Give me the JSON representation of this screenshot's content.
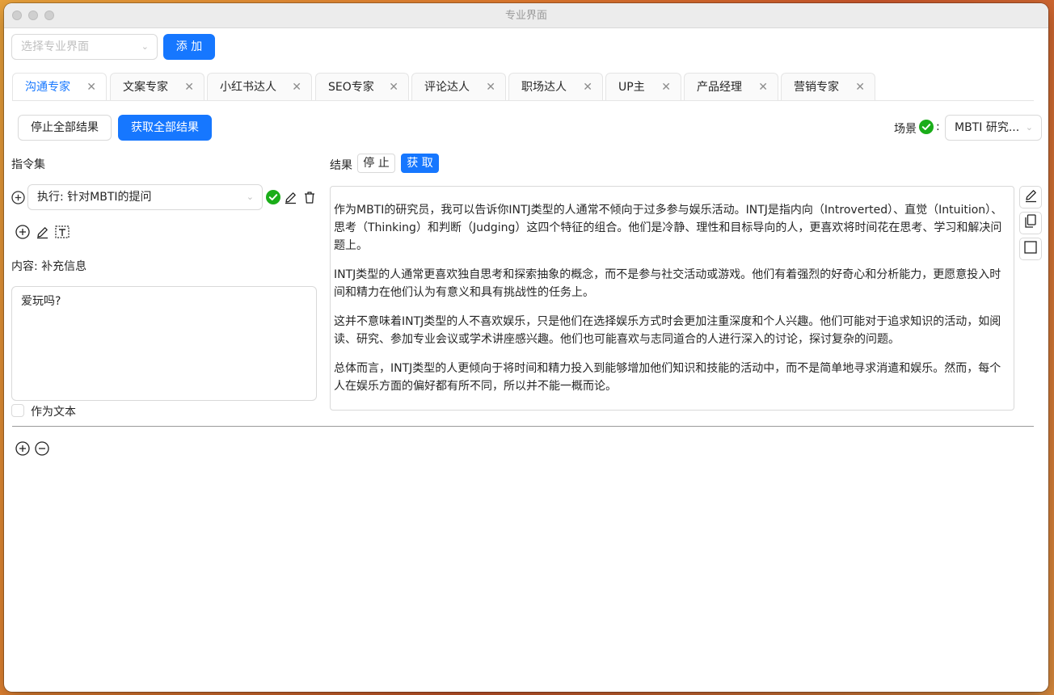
{
  "window": {
    "title": "专业界面"
  },
  "toolbar": {
    "select_placeholder": "选择专业界面",
    "add_label": "添 加"
  },
  "tabs": [
    {
      "label": "沟通专家"
    },
    {
      "label": "文案专家"
    },
    {
      "label": "小红书达人"
    },
    {
      "label": "SEO专家"
    },
    {
      "label": "评论达人"
    },
    {
      "label": "职场达人"
    },
    {
      "label": "UP主"
    },
    {
      "label": "产品经理"
    },
    {
      "label": "营销专家"
    }
  ],
  "actions": {
    "stop_all": "停止全部结果",
    "get_all": "获取全部结果"
  },
  "scene": {
    "label": "场景",
    "colon": ":",
    "value": "MBTI 研究..."
  },
  "commands": {
    "title": "指令集",
    "execute_value": "执行: 针对MBTI的提问",
    "content_label": "内容: 补充信息",
    "content_text": "爱玩吗?",
    "as_text_label": "作为文本"
  },
  "result": {
    "label": "结果",
    "stop": "停 止",
    "get": "获 取",
    "paragraphs": [
      "作为MBTI的研究员，我可以告诉你INTJ类型的人通常不倾向于过多参与娱乐活动。INTJ是指内向（Introverted）、直觉（Intuition）、思考（Thinking）和判断（Judging）这四个特征的组合。他们是冷静、理性和目标导向的人，更喜欢将时间花在思考、学习和解决问题上。",
      "INTJ类型的人通常更喜欢独自思考和探索抽象的概念，而不是参与社交活动或游戏。他们有着强烈的好奇心和分析能力，更愿意投入时间和精力在他们认为有意义和具有挑战性的任务上。",
      "这并不意味着INTJ类型的人不喜欢娱乐，只是他们在选择娱乐方式时会更加注重深度和个人兴趣。他们可能对于追求知识的活动，如阅读、研究、参加专业会议或学术讲座感兴趣。他们也可能喜欢与志同道合的人进行深入的讨论，探讨复杂的问题。",
      "总体而言，INTJ类型的人更倾向于将时间和精力投入到能够增加他们知识和技能的活动中，而不是简单地寻求消遣和娱乐。然而，每个人在娱乐方面的偏好都有所不同，所以并不能一概而论。"
    ]
  },
  "colors": {
    "primary": "#1677ff",
    "success": "#1aad19"
  }
}
